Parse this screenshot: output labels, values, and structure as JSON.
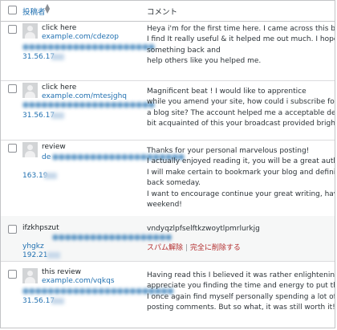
{
  "header": {
    "author_label": "投稿者",
    "comment_label": "コメント",
    "sort_icon": "sort-arrows-icon"
  },
  "rows": [
    {
      "author": "click here",
      "url": "example.com/cdezop",
      "email": "",
      "ip": "31.56.17",
      "lines": [
        "Heya i'm for the first time here. I came across this board and",
        "I find It really useful & it helped me out much. I hope to give",
        "something back and",
        "help others like you helped me."
      ]
    },
    {
      "author": "click here",
      "url": "example.com/mtesjghq",
      "email": "",
      "ip": "31.56.17",
      "lines": [
        "Magnificent beat ! I would like to apprentice",
        "while you amend your site, how could i subscribe for",
        "a blog site? The account helped me a acceptable deal. I had been tiny",
        "bit acquainted of this your broadcast provided bright clear concept"
      ]
    },
    {
      "author": "review",
      "url": "de",
      "email": "",
      "ip": "163.19",
      "lines": [
        "Thanks for your personal marvelous posting!",
        "I actually enjoyed reading it, you will be a great author.",
        "I will make certain to bookmark your blog and definitely will come",
        "back someday.",
        "I want to encourage continue your great writing, have a nice holiday",
        "weekend!"
      ]
    },
    {
      "author": "ifzkhpszut",
      "url": "",
      "email": "yhgkz",
      "ip": "192.21",
      "lines": [
        "vndyqzlpfselftkzwoytlpmrlurkjg"
      ],
      "actions": {
        "spam": "スパム解除",
        "sep": "|",
        "delete": "完全に削除する"
      }
    },
    {
      "author": "this review",
      "url": "example.com/vqkqs",
      "email": "",
      "ip": "31.56.17",
      "lines": [
        "Having read this I believed it was rather enlightening. I",
        "appreciate you finding the time and energy to put this article together.",
        "I once again find myself personally spending a lot of time both reading and",
        "posting comments. But so what, it was still worth it!"
      ]
    }
  ]
}
